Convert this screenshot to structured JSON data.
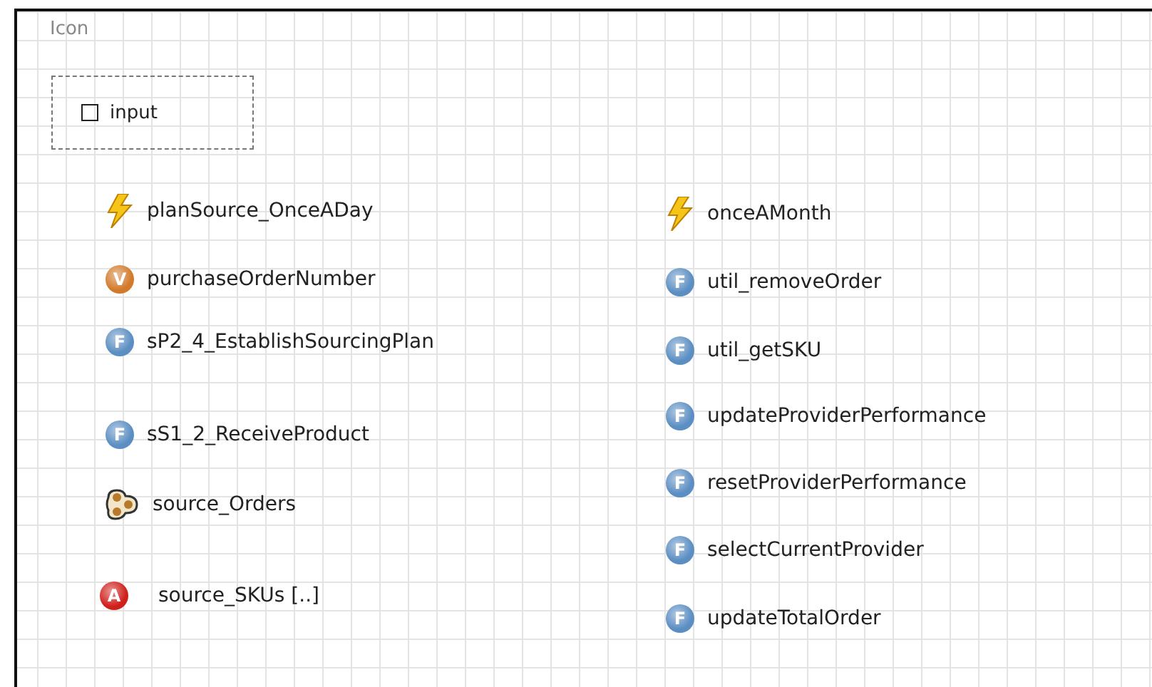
{
  "frame": {
    "title": "Icon"
  },
  "input_group": {
    "label": "input",
    "checked": false
  },
  "columns": [
    {
      "items": [
        {
          "kind": "event",
          "label": "planSource_OnceADay"
        },
        {
          "kind": "variable",
          "badge": "V",
          "label": "purchaseOrderNumber"
        },
        {
          "kind": "function",
          "badge": "F",
          "label": "sP2_4_EstablishSourcingPlan"
        },
        {
          "kind": "function",
          "badge": "F",
          "label": "sS1_2_ReceiveProduct"
        },
        {
          "kind": "collection",
          "label": "source_Orders"
        },
        {
          "kind": "agent",
          "badge": "A",
          "label": "source_SKUs [..]"
        }
      ]
    },
    {
      "items": [
        {
          "kind": "event",
          "label": "onceAMonth"
        },
        {
          "kind": "function",
          "badge": "F",
          "label": "util_removeOrder"
        },
        {
          "kind": "function",
          "badge": "F",
          "label": "util_getSKU"
        },
        {
          "kind": "function",
          "badge": "F",
          "label": "updateProviderPerformance"
        },
        {
          "kind": "function",
          "badge": "F",
          "label": "resetProviderPerformance"
        },
        {
          "kind": "function",
          "badge": "F",
          "label": "selectCurrentProvider"
        },
        {
          "kind": "function",
          "badge": "F",
          "label": "updateTotalOrder"
        }
      ]
    }
  ]
}
